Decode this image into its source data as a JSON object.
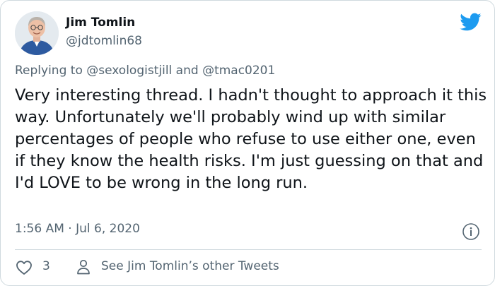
{
  "tweet": {
    "author_name": "Jim Tomlin",
    "author_handle": "@jdtomlin68",
    "replying_prefix": "Replying to",
    "replying_to_1": "@sexologistjill",
    "replying_and": "and",
    "replying_to_2": "@tmac0201",
    "text": "Very interesting thread. I hadn't thought to approach it this way. Unfortunately we'll probably wind up with similar percentages of people who refuse to use either one, even if they know the health risks. I'm just guessing on that and I'd LOVE to be wrong in the long run.",
    "timestamp": "1:56 AM · Jul 6, 2020",
    "like_count": "3",
    "see_others_label": "See Jim Tomlin’s other Tweets"
  },
  "icons": {
    "brand": "twitter-bird-icon",
    "info": "info-icon",
    "like": "heart-icon",
    "profile": "person-icon"
  },
  "colors": {
    "brand": "#1d9bf0",
    "text": "#0f1419",
    "secondary": "#536471",
    "border": "#cfd9de"
  }
}
